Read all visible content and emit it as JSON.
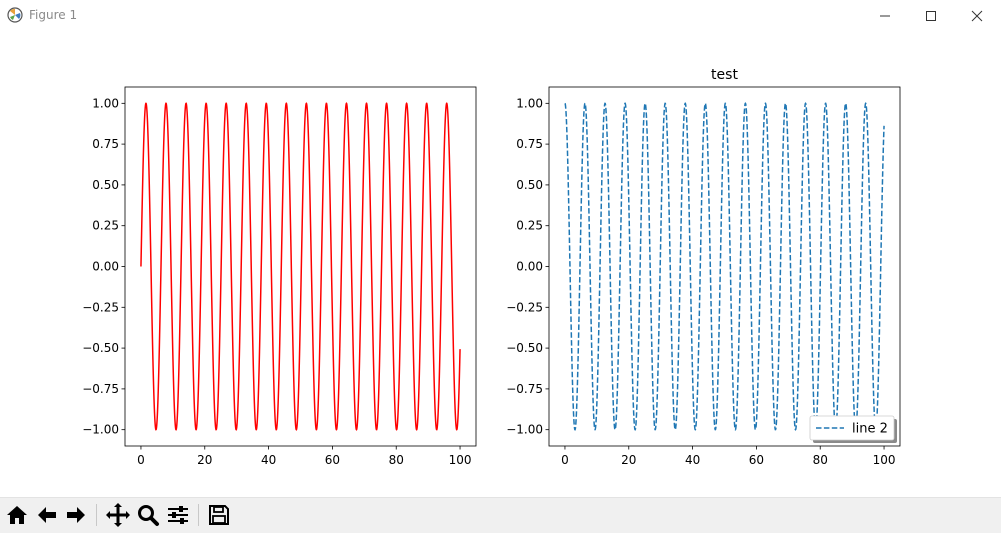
{
  "window": {
    "title": "Figure 1",
    "icons": [
      "matplotlib-logo-icon",
      "minimize-icon",
      "maximize-icon",
      "close-icon"
    ]
  },
  "toolbar": {
    "buttons": [
      "home-icon",
      "back-arrow-icon",
      "forward-arrow-icon",
      "pan-move-icon",
      "zoom-magnifier-icon",
      "configure-subplots-icon",
      "save-floppy-icon"
    ]
  },
  "chart_data": [
    {
      "type": "line",
      "title": "",
      "xlabel": "",
      "ylabel": "",
      "xlim": [
        -5,
        105
      ],
      "ylim": [
        -1.1,
        1.1
      ],
      "xticks": [
        "0",
        "20",
        "40",
        "60",
        "80",
        "100"
      ],
      "yticks": [
        "1.00",
        "0.75",
        "0.50",
        "0.25",
        "0.00",
        "−0.25",
        "−0.50",
        "−0.75",
        "−1.00"
      ],
      "series": [
        {
          "function": "sin(x)",
          "x_range": [
            0,
            100
          ],
          "color": "#ff0000",
          "linestyle": "solid"
        }
      ],
      "grid": false,
      "legend": null
    },
    {
      "type": "line",
      "title": "test",
      "xlabel": "",
      "ylabel": "",
      "xlim": [
        -5,
        105
      ],
      "ylim": [
        -1.1,
        1.1
      ],
      "xticks": [
        "0",
        "20",
        "40",
        "60",
        "80",
        "100"
      ],
      "yticks": [
        "1.00",
        "0.75",
        "0.50",
        "0.25",
        "0.00",
        "−0.25",
        "−0.50",
        "−0.75",
        "−1.00"
      ],
      "series": [
        {
          "name": "line 2",
          "function": "cos(x)",
          "x_range": [
            0,
            100
          ],
          "color": "#1f77b4",
          "linestyle": "dashed"
        }
      ],
      "grid": false,
      "legend": "lower-right"
    }
  ]
}
